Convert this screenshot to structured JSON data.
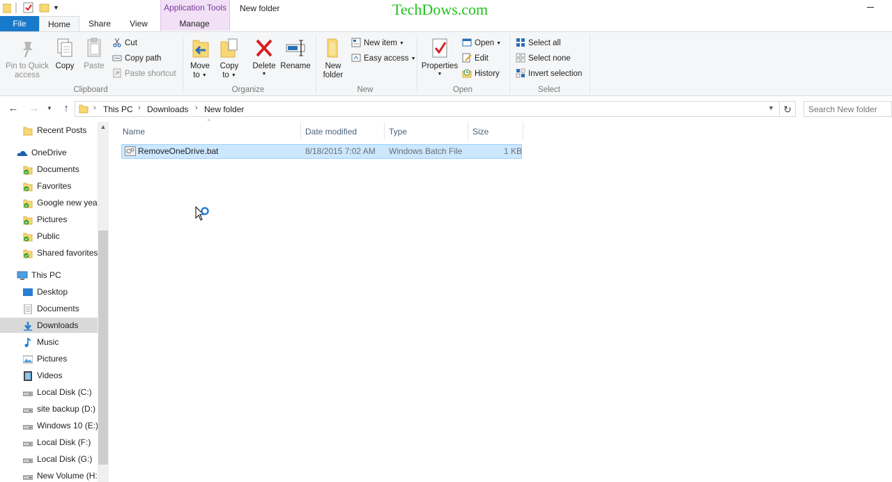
{
  "window": {
    "title": "New folder",
    "context_tab_title": "Application Tools",
    "watermark": "TechDows.com"
  },
  "tabs": {
    "file": "File",
    "home": "Home",
    "share": "Share",
    "view": "View",
    "manage": "Manage"
  },
  "ribbon": {
    "clipboard": {
      "label": "Clipboard",
      "pin": "Pin to Quick access",
      "pin_l1": "Pin to Quick",
      "pin_l2": "access",
      "copy": "Copy",
      "paste": "Paste",
      "cut": "Cut",
      "copy_path": "Copy path",
      "paste_shortcut": "Paste shortcut"
    },
    "organize": {
      "label": "Organize",
      "move_to_l1": "Move",
      "move_to_l2": "to",
      "copy_to_l1": "Copy",
      "copy_to_l2": "to",
      "delete": "Delete",
      "rename": "Rename"
    },
    "new": {
      "label": "New",
      "new_folder_l1": "New",
      "new_folder_l2": "folder",
      "new_item": "New item",
      "easy_access": "Easy access"
    },
    "open": {
      "label": "Open",
      "properties": "Properties",
      "open": "Open",
      "edit": "Edit",
      "history": "History"
    },
    "select": {
      "label": "Select",
      "select_all": "Select all",
      "select_none": "Select none",
      "invert_selection": "Invert selection"
    }
  },
  "address": {
    "crumbs": [
      "This PC",
      "Downloads",
      "New folder"
    ],
    "search_placeholder": "Search New folder"
  },
  "nav": {
    "items": [
      {
        "label": "Recent Posts",
        "icon": "folder-icon"
      },
      {
        "label": "OneDrive",
        "icon": "onedrive-icon"
      },
      {
        "label": "Documents",
        "icon": "synced-folder-icon"
      },
      {
        "label": "Favorites",
        "icon": "synced-folder-icon"
      },
      {
        "label": "Google new year",
        "icon": "synced-folder-icon"
      },
      {
        "label": "Pictures",
        "icon": "synced-folder-icon"
      },
      {
        "label": "Public",
        "icon": "synced-folder-icon"
      },
      {
        "label": "Shared favorites",
        "icon": "synced-folder-icon"
      },
      {
        "label": "This PC",
        "icon": "computer-icon"
      },
      {
        "label": "Desktop",
        "icon": "desktop-icon"
      },
      {
        "label": "Documents",
        "icon": "documents-icon"
      },
      {
        "label": "Downloads",
        "icon": "downloads-icon"
      },
      {
        "label": "Music",
        "icon": "music-icon"
      },
      {
        "label": "Pictures",
        "icon": "pictures-icon"
      },
      {
        "label": "Videos",
        "icon": "videos-icon"
      },
      {
        "label": "Local Disk (C:)",
        "icon": "drive-icon"
      },
      {
        "label": "site backup (D:)",
        "icon": "drive-icon"
      },
      {
        "label": "Windows 10 (E:)",
        "icon": "drive-icon"
      },
      {
        "label": "Local Disk (F:)",
        "icon": "drive-icon"
      },
      {
        "label": "Local Disk (G:)",
        "icon": "drive-icon"
      },
      {
        "label": "New Volume (H:",
        "icon": "drive-icon"
      }
    ],
    "selected": "Downloads"
  },
  "files": {
    "columns": [
      "Name",
      "Date modified",
      "Type",
      "Size"
    ],
    "rows": [
      {
        "name": "RemoveOneDrive.bat",
        "date": "8/18/2015 7:02 AM",
        "type": "Windows Batch File",
        "size": "1 KB"
      }
    ]
  },
  "colors": {
    "file_tab": "#1979ca",
    "context_tab": "#f2e0f7",
    "selection": "#cce8ff",
    "watermark": "#21c21b"
  }
}
